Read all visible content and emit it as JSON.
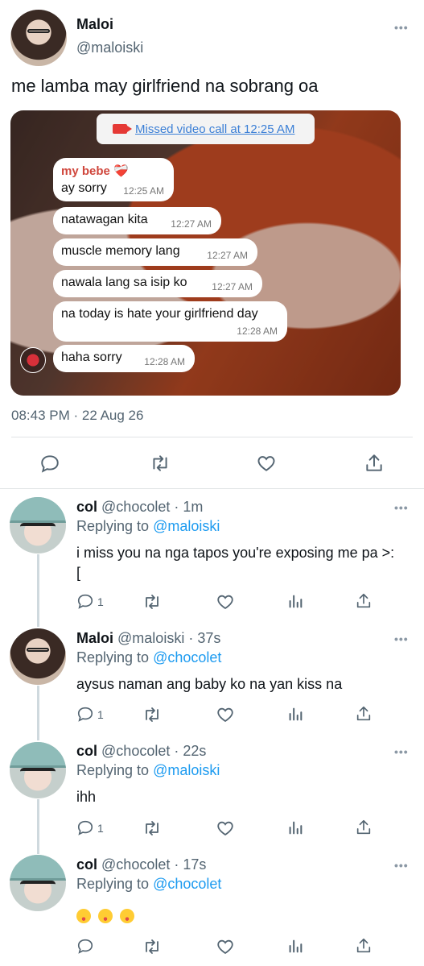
{
  "main_tweet": {
    "author_name": "Maloi",
    "author_handle": "@maloiski",
    "text": "me lamba may girlfriend na sobrang oa",
    "timestamp": "08:43 PM · 22 Aug 26",
    "media": {
      "call_notice": "Missed video call at 12:25 AM",
      "sender_name": "my bebe ❤️‍🩹",
      "messages": [
        {
          "text": "ay sorry",
          "time": "12:25 AM"
        },
        {
          "text": "natawagan kita",
          "time": "12:27 AM"
        },
        {
          "text": "muscle memory lang",
          "time": "12:27 AM"
        },
        {
          "text": "nawala lang sa isip ko",
          "time": "12:27 AM"
        },
        {
          "text": "na today is hate your girlfriend day",
          "time": "12:28 AM"
        },
        {
          "text": "haha sorry",
          "time": "12:28 AM"
        }
      ]
    }
  },
  "replies": [
    {
      "name": "col",
      "handle": "@chocolet · 1m",
      "replying_prefix": "Replying to",
      "replying_to": "@maloiski",
      "text": "i miss you na nga tapos you're exposing me pa >:[",
      "reply_count": "1"
    },
    {
      "name": "Maloi",
      "handle": "@maloiski · 37s",
      "replying_prefix": "Replying to",
      "replying_to": "@chocolet",
      "text": "aysus naman ang baby ko na yan kiss na",
      "reply_count": "1"
    },
    {
      "name": "col",
      "handle": "@chocolet · 22s",
      "replying_prefix": "Replying to",
      "replying_to": "@maloiski",
      "text": "ihh",
      "reply_count": "1"
    },
    {
      "name": "col",
      "handle": "@chocolet · 17s",
      "replying_prefix": "Replying to",
      "replying_to": "@chocolet",
      "text": "",
      "reply_count": ""
    }
  ],
  "icons": {
    "more": "more-icon",
    "reply": "reply-icon",
    "retweet": "retweet-icon",
    "like": "like-icon",
    "share": "share-icon",
    "analytics": "analytics-icon"
  },
  "colors": {
    "accent": "#1d9bf0",
    "secondary_text": "#536471",
    "call_link": "#3b7fd6",
    "sender_name": "#d0473d"
  }
}
